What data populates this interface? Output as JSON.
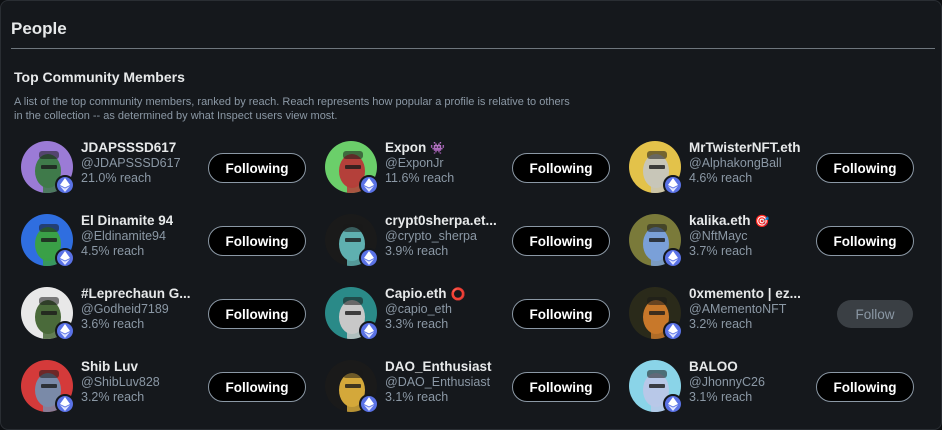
{
  "panel": {
    "title": "People",
    "section_title": "Top Community Members",
    "section_description": "A list of the top community members, ranked by reach. Reach represents how popular a profile is relative to others in the collection -- as determined by what Inspect users view most."
  },
  "colors": {
    "background": "#15181c",
    "text_primary": "#e7e9ea",
    "text_secondary": "#8b98a5",
    "chain_badge": "#5a72e6"
  },
  "members": [
    {
      "name": "JDAPSSSD617",
      "handle": "@JDAPSSSD617",
      "reach": "21.0% reach",
      "button": "Following",
      "emoji": "",
      "avatar_bg": "#9b7bd6",
      "avatar_fg": "#3f7a4a"
    },
    {
      "name": "Expon",
      "handle": "@ExponJr",
      "reach": "11.6% reach",
      "button": "Following",
      "emoji": "👾",
      "avatar_bg": "#6bcf6a",
      "avatar_fg": "#b4403a"
    },
    {
      "name": "MrTwisterNFT.eth",
      "handle": "@AlphakongBall",
      "reach": "4.6% reach",
      "button": "Following",
      "emoji": "",
      "avatar_bg": "#e3c24a",
      "avatar_fg": "#c8c6b8"
    },
    {
      "name": "El Dinamite 94",
      "handle": "@Eldinamite94",
      "reach": "4.5% reach",
      "button": "Following",
      "emoji": "",
      "avatar_bg": "#2f6ee0",
      "avatar_fg": "#3aa047"
    },
    {
      "name": "crypt0sherpa.et...",
      "handle": "@crypto_sherpa",
      "reach": "3.9% reach",
      "button": "Following",
      "emoji": "",
      "avatar_bg": "#1a1a1a",
      "avatar_fg": "#5fb0b0"
    },
    {
      "name": "kalika.eth",
      "handle": "@NftMayc",
      "reach": "3.7% reach",
      "button": "Following",
      "emoji": "🎯",
      "avatar_bg": "#7a7a3a",
      "avatar_fg": "#7aa0d8"
    },
    {
      "name": "#Leprechaun G...",
      "handle": "@Godheid7189",
      "reach": "3.6% reach",
      "button": "Following",
      "emoji": "",
      "avatar_bg": "#e8e8e8",
      "avatar_fg": "#4a6a3a"
    },
    {
      "name": "Capio.eth",
      "handle": "@capio_eth",
      "reach": "3.3% reach",
      "button": "Following",
      "emoji": "⭕",
      "avatar_bg": "#2a8a88",
      "avatar_fg": "#c8c8c8"
    },
    {
      "name": "0xmemento | ez...",
      "handle": "@AMementoNFT",
      "reach": "3.2% reach",
      "button": "Follow",
      "emoji": "",
      "avatar_bg": "#2a2a1a",
      "avatar_fg": "#c8782a"
    },
    {
      "name": "Shib Luv",
      "handle": "@ShibLuv828",
      "reach": "3.2% reach",
      "button": "Following",
      "emoji": "",
      "avatar_bg": "#d43a3a",
      "avatar_fg": "#7a8aa8"
    },
    {
      "name": "DAO_Enthusiast",
      "handle": "@DAO_Enthusiast",
      "reach": "3.1% reach",
      "button": "Following",
      "emoji": "",
      "avatar_bg": "#1a1a1a",
      "avatar_fg": "#d4a83a"
    },
    {
      "name": "BALOO",
      "handle": "@JhonnyC26",
      "reach": "3.1% reach",
      "button": "Following",
      "emoji": "",
      "avatar_bg": "#8ad4e8",
      "avatar_fg": "#b8c8e8"
    }
  ]
}
